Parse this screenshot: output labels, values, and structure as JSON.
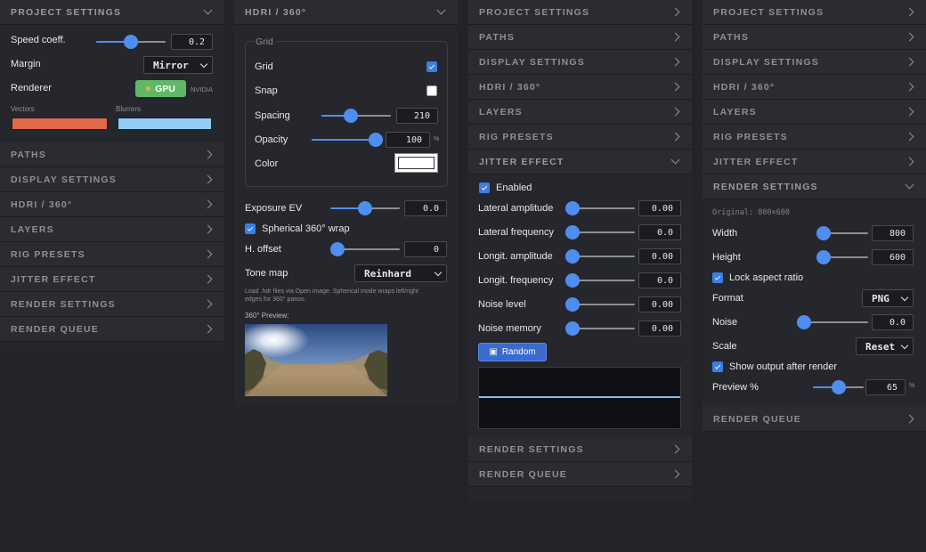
{
  "panel1": {
    "header": "PROJECT SETTINGS",
    "speed_label": "Speed coeff.",
    "speed_value": "0.2",
    "speed_level": 0.5,
    "margin_label": "Margin",
    "margin_value": "Mirror",
    "renderer_label": "Renderer",
    "gpu_label": "GPU",
    "gpu_vendor": "NVIDIA",
    "vectors_label": "Vectors",
    "blurrers_label": "Blurrers",
    "vectors_color": "#e0694a",
    "blurrers_color": "#8fcdf7",
    "sections": [
      "PATHS",
      "DISPLAY SETTINGS",
      "HDRI / 360°",
      "LAYERS",
      "RIG PRESETS",
      "JITTER EFFECT",
      "RENDER SETTINGS",
      "RENDER QUEUE"
    ]
  },
  "panel2": {
    "header": "HDRI / 360°",
    "grid_group": "Grid",
    "grid_label": "Grid",
    "snap_label": "Snap",
    "spacing_label": "Spacing",
    "spacing_value": "210",
    "spacing_level": 0.42,
    "opacity_label": "Opacity",
    "opacity_value": "100",
    "opacity_unit": "%",
    "opacity_level": 1.0,
    "color_label": "Color",
    "color_value": "#ffffff",
    "exposure_label": "Exposure EV",
    "exposure_value": "0.0",
    "exposure_level": 0.5,
    "spherical_label": "Spherical 360° wrap",
    "hoffset_label": "H. offset",
    "hoffset_value": "0",
    "hoffset_level": 0.0,
    "tonemap_label": "Tone map",
    "tonemap_value": "Reinhard",
    "help_text_1": "Load .hdr files via Open image. Spherical mode wraps left/right",
    "help_text_2": "edges for 360° panos.",
    "preview_label": "360° Preview:"
  },
  "panel3": {
    "sections_top": [
      "PROJECT SETTINGS",
      "PATHS",
      "DISPLAY SETTINGS",
      "HDRI / 360°",
      "LAYERS",
      "RIG PRESETS"
    ],
    "open_header": "JITTER EFFECT",
    "enabled_label": "Enabled",
    "params": [
      {
        "label": "Lateral amplitude",
        "value": "0.00",
        "level": 0.0
      },
      {
        "label": "Lateral frequency",
        "value": "0.0",
        "level": 0.0
      },
      {
        "label": "Longit. amplitude",
        "value": "0.00",
        "level": 0.0
      },
      {
        "label": "Longit. frequency",
        "value": "0.0",
        "level": 0.0
      },
      {
        "label": "Noise level",
        "value": "0.00",
        "level": 0.0
      },
      {
        "label": "Noise memory",
        "value": "0.00",
        "level": 0.0
      }
    ],
    "random_label": "Random",
    "sections_bottom": [
      "RENDER SETTINGS",
      "RENDER QUEUE"
    ]
  },
  "panel4": {
    "sections_top": [
      "PROJECT SETTINGS",
      "PATHS",
      "DISPLAY SETTINGS",
      "HDRI / 360°",
      "LAYERS",
      "RIG PRESETS",
      "JITTER EFFECT"
    ],
    "open_header": "RENDER SETTINGS",
    "original_text": "Original: 800×600",
    "width_label": "Width",
    "width_value": "800",
    "width_level": 0.0,
    "height_label": "Height",
    "height_value": "600",
    "height_level": 0.0,
    "lock_label": "Lock aspect ratio",
    "format_label": "Format",
    "format_value": "PNG",
    "noise_label": "Noise",
    "noise_value": "0.0",
    "noise_level": 0.0,
    "scale_label": "Scale",
    "scale_value": "Reset",
    "show_output_label": "Show output after render",
    "preview_label": "Preview %",
    "preview_value": "65",
    "preview_unit": "%",
    "preview_level": 0.5,
    "sections_bottom": [
      "RENDER QUEUE"
    ]
  }
}
